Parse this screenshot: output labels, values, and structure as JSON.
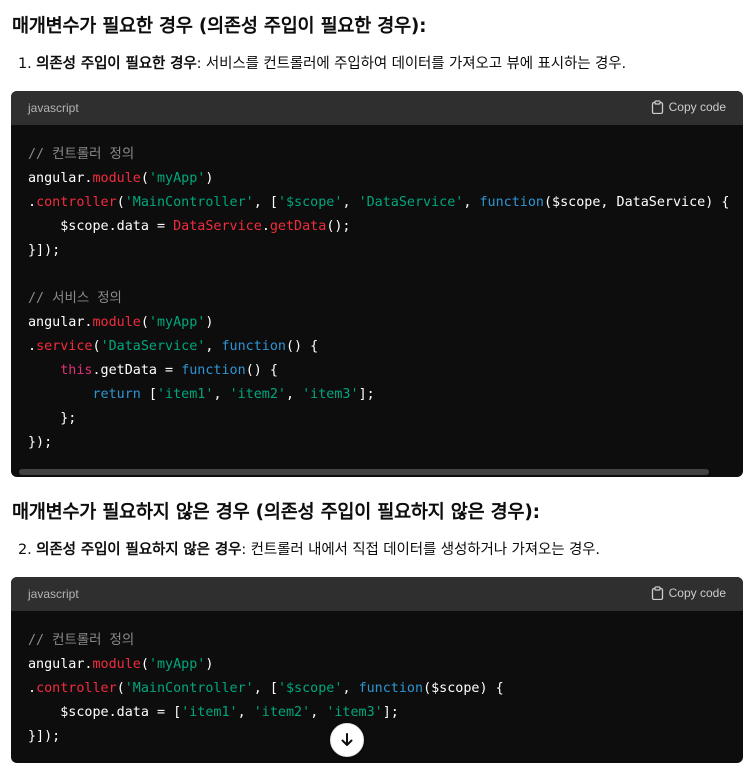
{
  "section1": {
    "heading": "매개변수가 필요한 경우 (의존성 주입이 필요한 경우):",
    "item_number": "1.",
    "item_bold": "의존성 주입이 필요한 경우",
    "item_text": ": 서비스를 컨트롤러에 주입하여 데이터를 가져오고 뷰에 표시하는 경우."
  },
  "code1": {
    "language": "javascript",
    "copy_label": "Copy code",
    "lines": [
      [
        {
          "t": "// 컨트롤러 정의",
          "c": "comment"
        }
      ],
      [
        {
          "t": "angular."
        },
        {
          "t": "module",
          "c": "prop"
        },
        {
          "t": "("
        },
        {
          "t": "'myApp'",
          "c": "str"
        },
        {
          "t": ")"
        }
      ],
      [
        {
          "t": "."
        },
        {
          "t": "controller",
          "c": "prop"
        },
        {
          "t": "("
        },
        {
          "t": "'MainController'",
          "c": "str"
        },
        {
          "t": ", ["
        },
        {
          "t": "'$scope'",
          "c": "str"
        },
        {
          "t": ", "
        },
        {
          "t": "'DataService'",
          "c": "str"
        },
        {
          "t": ", "
        },
        {
          "t": "function",
          "c": "kw"
        },
        {
          "t": "($scope, DataService) {"
        }
      ],
      [
        {
          "t": "    $scope.data = "
        },
        {
          "t": "DataService",
          "c": "prop"
        },
        {
          "t": "."
        },
        {
          "t": "getData",
          "c": "prop"
        },
        {
          "t": "();"
        }
      ],
      [
        {
          "t": "}]);"
        }
      ],
      [
        {
          "t": ""
        }
      ],
      [
        {
          "t": "// 서비스 정의",
          "c": "comment"
        }
      ],
      [
        {
          "t": "angular."
        },
        {
          "t": "module",
          "c": "prop"
        },
        {
          "t": "("
        },
        {
          "t": "'myApp'",
          "c": "str"
        },
        {
          "t": ")"
        }
      ],
      [
        {
          "t": "."
        },
        {
          "t": "service",
          "c": "prop"
        },
        {
          "t": "("
        },
        {
          "t": "'DataService'",
          "c": "str"
        },
        {
          "t": ", "
        },
        {
          "t": "function",
          "c": "kw"
        },
        {
          "t": "() {"
        }
      ],
      [
        {
          "t": "    "
        },
        {
          "t": "this",
          "c": "this"
        },
        {
          "t": ".getData = "
        },
        {
          "t": "function",
          "c": "kw"
        },
        {
          "t": "() {"
        }
      ],
      [
        {
          "t": "        "
        },
        {
          "t": "return",
          "c": "kw"
        },
        {
          "t": " ["
        },
        {
          "t": "'item1'",
          "c": "str"
        },
        {
          "t": ", "
        },
        {
          "t": "'item2'",
          "c": "str"
        },
        {
          "t": ", "
        },
        {
          "t": "'item3'",
          "c": "str"
        },
        {
          "t": "];"
        }
      ],
      [
        {
          "t": "    };"
        }
      ],
      [
        {
          "t": "});"
        }
      ]
    ]
  },
  "section2": {
    "heading": "매개변수가 필요하지 않은 경우 (의존성 주입이 필요하지 않은 경우):",
    "item_number": "2.",
    "item_bold": "의존성 주입이 필요하지 않은 경우",
    "item_text": ": 컨트롤러 내에서 직접 데이터를 생성하거나 가져오는 경우."
  },
  "code2": {
    "language": "javascript",
    "copy_label": "Copy code",
    "lines": [
      [
        {
          "t": "// 컨트롤러 정의",
          "c": "comment"
        }
      ],
      [
        {
          "t": "angular."
        },
        {
          "t": "module",
          "c": "prop"
        },
        {
          "t": "("
        },
        {
          "t": "'myApp'",
          "c": "str"
        },
        {
          "t": ")"
        }
      ],
      [
        {
          "t": "."
        },
        {
          "t": "controller",
          "c": "prop"
        },
        {
          "t": "("
        },
        {
          "t": "'MainController'",
          "c": "str"
        },
        {
          "t": ", ["
        },
        {
          "t": "'$scope'",
          "c": "str"
        },
        {
          "t": ", "
        },
        {
          "t": "function",
          "c": "kw"
        },
        {
          "t": "($scope) {"
        }
      ],
      [
        {
          "t": "    $scope.data = ["
        },
        {
          "t": "'item1'",
          "c": "str"
        },
        {
          "t": ", "
        },
        {
          "t": "'item2'",
          "c": "str"
        },
        {
          "t": ", "
        },
        {
          "t": "'item3'",
          "c": "str"
        },
        {
          "t": "];"
        }
      ],
      [
        {
          "t": "}]);"
        }
      ]
    ]
  },
  "scroll_button": {
    "icon": "arrow-down-icon"
  },
  "colors": {
    "code_bg": "#0d0d0d",
    "header_bg": "#2f2f2f",
    "comment": "#8b8b8b",
    "property": "#f22c3d",
    "string": "#00a67d",
    "keyword": "#2e95d3",
    "this": "#df3079"
  }
}
